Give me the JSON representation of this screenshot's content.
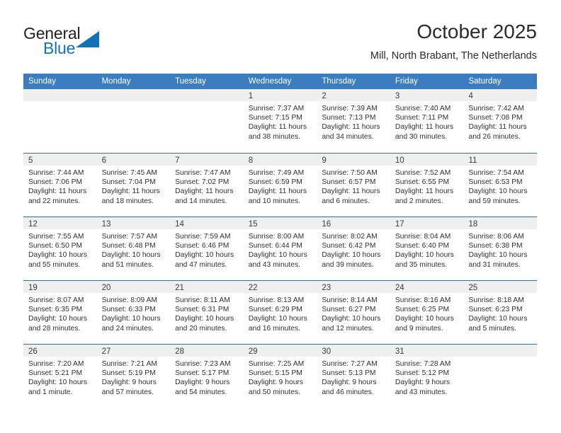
{
  "brand": {
    "name_part1": "General",
    "name_part2": "Blue",
    "accent_color": "#1272b8",
    "triangle_color": "#1272b8"
  },
  "header": {
    "title": "October 2025",
    "subtitle": "Mill, North Brabant, The Netherlands"
  },
  "theme": {
    "header_row_bg": "#3b7dbf",
    "week_divider": "#2f6fab",
    "daynum_band_bg": "#efefef",
    "text_color": "#2f2f2f"
  },
  "weekdays": [
    "Sunday",
    "Monday",
    "Tuesday",
    "Wednesday",
    "Thursday",
    "Friday",
    "Saturday"
  ],
  "weeks": [
    [
      {
        "day": "",
        "lines": []
      },
      {
        "day": "",
        "lines": []
      },
      {
        "day": "",
        "lines": []
      },
      {
        "day": "1",
        "lines": [
          "Sunrise: 7:37 AM",
          "Sunset: 7:15 PM",
          "Daylight: 11 hours",
          "and 38 minutes."
        ]
      },
      {
        "day": "2",
        "lines": [
          "Sunrise: 7:39 AM",
          "Sunset: 7:13 PM",
          "Daylight: 11 hours",
          "and 34 minutes."
        ]
      },
      {
        "day": "3",
        "lines": [
          "Sunrise: 7:40 AM",
          "Sunset: 7:11 PM",
          "Daylight: 11 hours",
          "and 30 minutes."
        ]
      },
      {
        "day": "4",
        "lines": [
          "Sunrise: 7:42 AM",
          "Sunset: 7:08 PM",
          "Daylight: 11 hours",
          "and 26 minutes."
        ]
      }
    ],
    [
      {
        "day": "5",
        "lines": [
          "Sunrise: 7:44 AM",
          "Sunset: 7:06 PM",
          "Daylight: 11 hours",
          "and 22 minutes."
        ]
      },
      {
        "day": "6",
        "lines": [
          "Sunrise: 7:45 AM",
          "Sunset: 7:04 PM",
          "Daylight: 11 hours",
          "and 18 minutes."
        ]
      },
      {
        "day": "7",
        "lines": [
          "Sunrise: 7:47 AM",
          "Sunset: 7:02 PM",
          "Daylight: 11 hours",
          "and 14 minutes."
        ]
      },
      {
        "day": "8",
        "lines": [
          "Sunrise: 7:49 AM",
          "Sunset: 6:59 PM",
          "Daylight: 11 hours",
          "and 10 minutes."
        ]
      },
      {
        "day": "9",
        "lines": [
          "Sunrise: 7:50 AM",
          "Sunset: 6:57 PM",
          "Daylight: 11 hours",
          "and 6 minutes."
        ]
      },
      {
        "day": "10",
        "lines": [
          "Sunrise: 7:52 AM",
          "Sunset: 6:55 PM",
          "Daylight: 11 hours",
          "and 2 minutes."
        ]
      },
      {
        "day": "11",
        "lines": [
          "Sunrise: 7:54 AM",
          "Sunset: 6:53 PM",
          "Daylight: 10 hours",
          "and 59 minutes."
        ]
      }
    ],
    [
      {
        "day": "12",
        "lines": [
          "Sunrise: 7:55 AM",
          "Sunset: 6:50 PM",
          "Daylight: 10 hours",
          "and 55 minutes."
        ]
      },
      {
        "day": "13",
        "lines": [
          "Sunrise: 7:57 AM",
          "Sunset: 6:48 PM",
          "Daylight: 10 hours",
          "and 51 minutes."
        ]
      },
      {
        "day": "14",
        "lines": [
          "Sunrise: 7:59 AM",
          "Sunset: 6:46 PM",
          "Daylight: 10 hours",
          "and 47 minutes."
        ]
      },
      {
        "day": "15",
        "lines": [
          "Sunrise: 8:00 AM",
          "Sunset: 6:44 PM",
          "Daylight: 10 hours",
          "and 43 minutes."
        ]
      },
      {
        "day": "16",
        "lines": [
          "Sunrise: 8:02 AM",
          "Sunset: 6:42 PM",
          "Daylight: 10 hours",
          "and 39 minutes."
        ]
      },
      {
        "day": "17",
        "lines": [
          "Sunrise: 8:04 AM",
          "Sunset: 6:40 PM",
          "Daylight: 10 hours",
          "and 35 minutes."
        ]
      },
      {
        "day": "18",
        "lines": [
          "Sunrise: 8:06 AM",
          "Sunset: 6:38 PM",
          "Daylight: 10 hours",
          "and 31 minutes."
        ]
      }
    ],
    [
      {
        "day": "19",
        "lines": [
          "Sunrise: 8:07 AM",
          "Sunset: 6:35 PM",
          "Daylight: 10 hours",
          "and 28 minutes."
        ]
      },
      {
        "day": "20",
        "lines": [
          "Sunrise: 8:09 AM",
          "Sunset: 6:33 PM",
          "Daylight: 10 hours",
          "and 24 minutes."
        ]
      },
      {
        "day": "21",
        "lines": [
          "Sunrise: 8:11 AM",
          "Sunset: 6:31 PM",
          "Daylight: 10 hours",
          "and 20 minutes."
        ]
      },
      {
        "day": "22",
        "lines": [
          "Sunrise: 8:13 AM",
          "Sunset: 6:29 PM",
          "Daylight: 10 hours",
          "and 16 minutes."
        ]
      },
      {
        "day": "23",
        "lines": [
          "Sunrise: 8:14 AM",
          "Sunset: 6:27 PM",
          "Daylight: 10 hours",
          "and 12 minutes."
        ]
      },
      {
        "day": "24",
        "lines": [
          "Sunrise: 8:16 AM",
          "Sunset: 6:25 PM",
          "Daylight: 10 hours",
          "and 9 minutes."
        ]
      },
      {
        "day": "25",
        "lines": [
          "Sunrise: 8:18 AM",
          "Sunset: 6:23 PM",
          "Daylight: 10 hours",
          "and 5 minutes."
        ]
      }
    ],
    [
      {
        "day": "26",
        "lines": [
          "Sunrise: 7:20 AM",
          "Sunset: 5:21 PM",
          "Daylight: 10 hours",
          "and 1 minute."
        ]
      },
      {
        "day": "27",
        "lines": [
          "Sunrise: 7:21 AM",
          "Sunset: 5:19 PM",
          "Daylight: 9 hours",
          "and 57 minutes."
        ]
      },
      {
        "day": "28",
        "lines": [
          "Sunrise: 7:23 AM",
          "Sunset: 5:17 PM",
          "Daylight: 9 hours",
          "and 54 minutes."
        ]
      },
      {
        "day": "29",
        "lines": [
          "Sunrise: 7:25 AM",
          "Sunset: 5:15 PM",
          "Daylight: 9 hours",
          "and 50 minutes."
        ]
      },
      {
        "day": "30",
        "lines": [
          "Sunrise: 7:27 AM",
          "Sunset: 5:13 PM",
          "Daylight: 9 hours",
          "and 46 minutes."
        ]
      },
      {
        "day": "31",
        "lines": [
          "Sunrise: 7:28 AM",
          "Sunset: 5:12 PM",
          "Daylight: 9 hours",
          "and 43 minutes."
        ]
      },
      {
        "day": "",
        "lines": []
      }
    ]
  ]
}
